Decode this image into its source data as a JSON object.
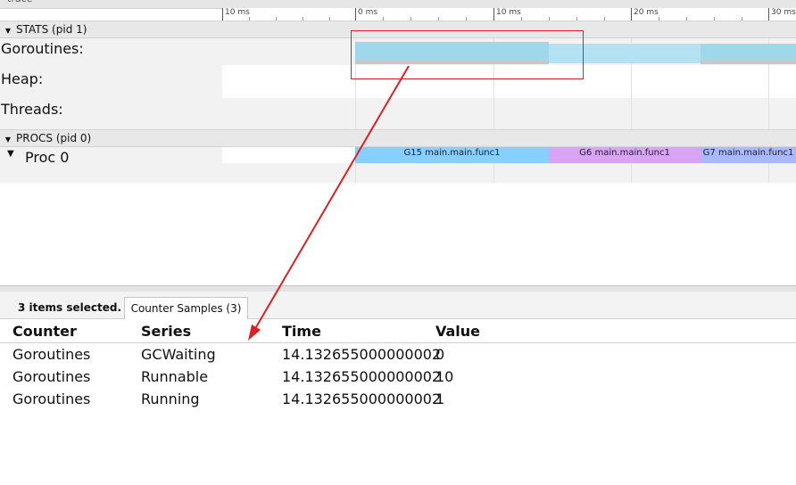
{
  "window": {
    "title": "trace"
  },
  "ruler": {
    "ticks": [
      "10 ms",
      "0 ms",
      "10 ms",
      "20 ms",
      "30 ms"
    ]
  },
  "stats_group": {
    "label": "STATS (pid 1)",
    "rows": [
      "Goroutines:",
      "Heap:",
      "Threads:"
    ]
  },
  "procs_group": {
    "label": "PROCS (pid 0)",
    "rows": [
      "Proc 0"
    ]
  },
  "slices": [
    {
      "label": "G15 main.main.func1",
      "color": "#88cfff"
    },
    {
      "label": "G6 main.main.func1",
      "color": "#d9a4f5"
    },
    {
      "label": "G7 main.main.func1",
      "color": "#a9b8ff"
    }
  ],
  "counter_colors": {
    "gcwaiting": "#9fd8ea",
    "runnable": "#b4e2f2",
    "running": "#c8c8c8"
  },
  "annotation": {
    "color": "#e02020"
  },
  "bottom_panel": {
    "selection_info": "3 items selected.",
    "tab_label": "Counter Samples (3)",
    "columns": [
      "Counter",
      "Series",
      "Time",
      "Value"
    ],
    "rows": [
      {
        "counter": "Goroutines",
        "series": "GCWaiting",
        "time": "14.132655000000002",
        "value": "0"
      },
      {
        "counter": "Goroutines",
        "series": "Runnable",
        "time": "14.132655000000002",
        "value": "10"
      },
      {
        "counter": "Goroutines",
        "series": "Running",
        "time": "14.132655000000002",
        "value": "1"
      }
    ]
  }
}
